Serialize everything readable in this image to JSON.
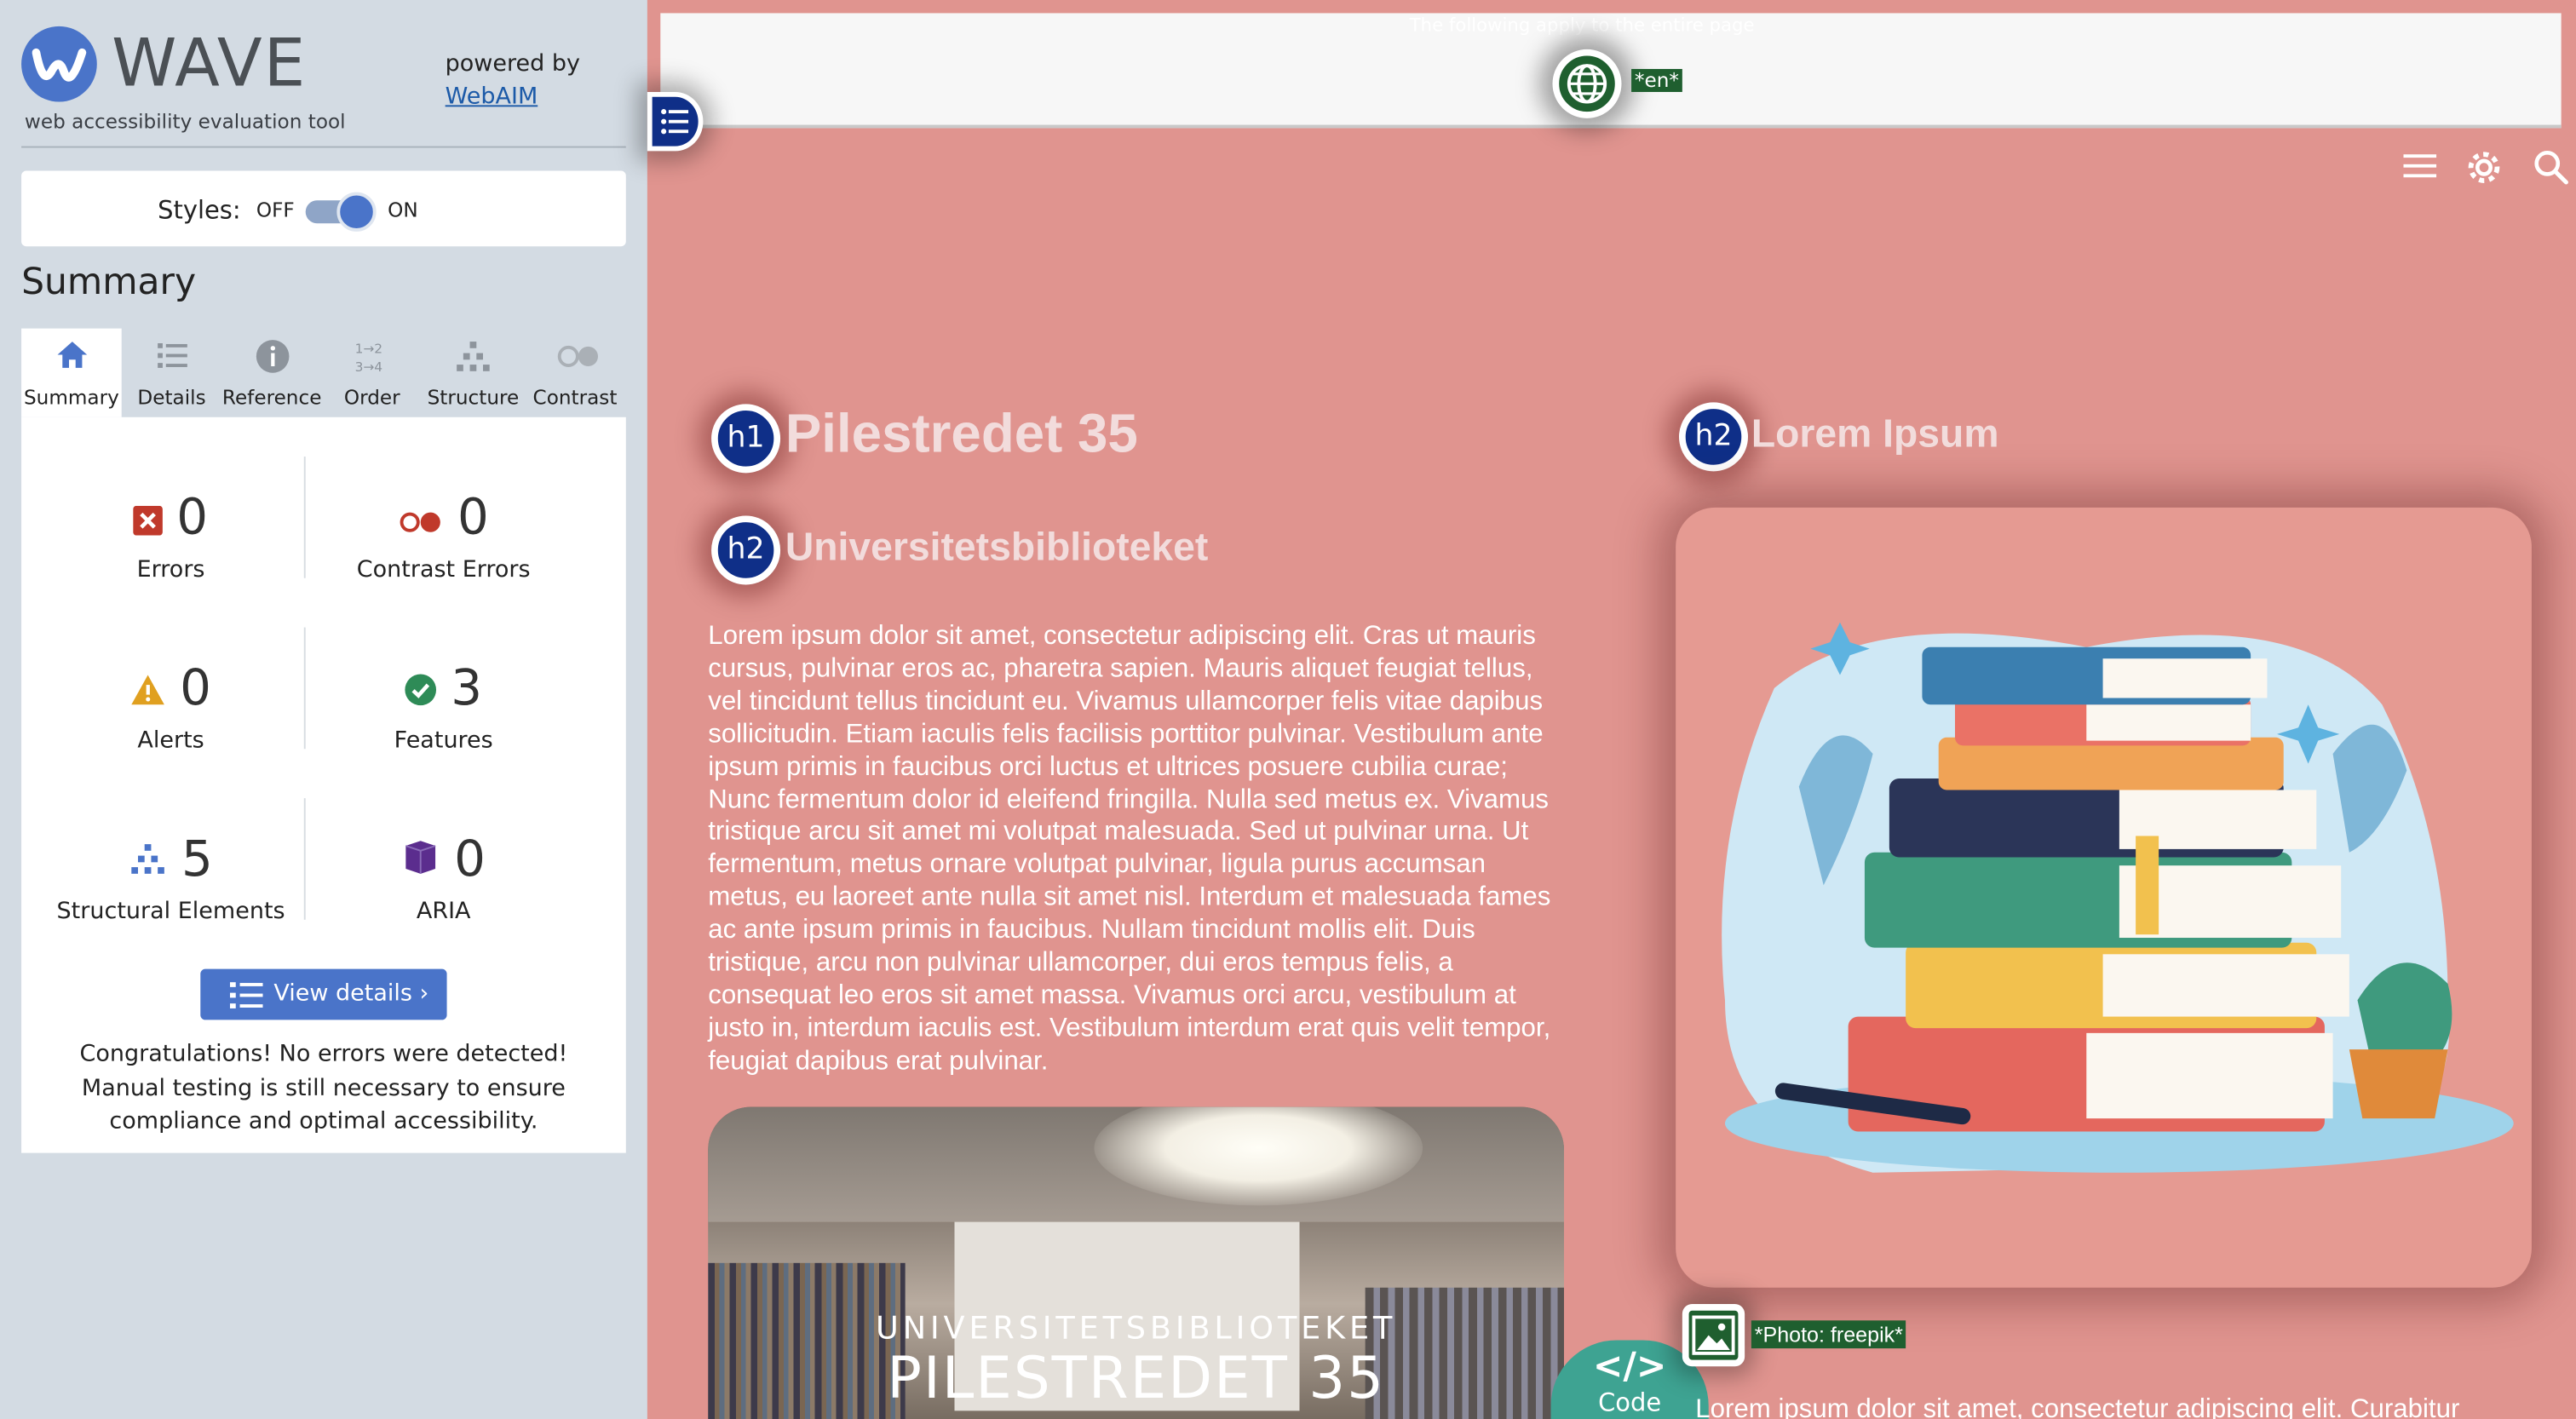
{
  "wave": {
    "logo_text": "WAVE",
    "logo_sub": "web accessibility evaluation tool",
    "powered_by": "powered by",
    "webaim_link": "WebAIM",
    "styles": {
      "label": "Styles:",
      "off": "OFF",
      "on": "ON",
      "value": "ON"
    },
    "summary_heading": "Summary",
    "tabs": [
      {
        "label": "Summary",
        "icon": "home-icon",
        "active": true
      },
      {
        "label": "Details",
        "icon": "list-icon",
        "active": false
      },
      {
        "label": "Reference",
        "icon": "info-icon",
        "active": false
      },
      {
        "label": "Order",
        "icon": "order-icon",
        "active": false
      },
      {
        "label": "Structure",
        "icon": "structure-icon",
        "active": false
      },
      {
        "label": "Contrast",
        "icon": "contrast-icon",
        "active": false
      }
    ],
    "counts": {
      "errors": {
        "value": "0",
        "label": "Errors",
        "color": "#c0392b"
      },
      "contrast_errors": {
        "value": "0",
        "label": "Contrast Errors",
        "color": "#c0392b"
      },
      "alerts": {
        "value": "0",
        "label": "Alerts",
        "color": "#e0a020"
      },
      "features": {
        "value": "3",
        "label": "Features",
        "color": "#2e8b57"
      },
      "structural": {
        "value": "5",
        "label": "Structural Elements",
        "color": "#4a74c9"
      },
      "aria": {
        "value": "0",
        "label": "ARIA",
        "color": "#5b2d8e"
      }
    },
    "view_details": "View details ›",
    "congrats": "Congratulations! No errors were detected! Manual testing is still necessary to ensure compliance and optimal accessibility."
  },
  "page": {
    "skip_text": "The following apply to the entire page",
    "lang_tag": "*en*",
    "h1_badge": "h1",
    "h1": "Pilestredet 35",
    "h2_badge": "h2",
    "h2_left": "Universitetsbiblioteket",
    "h2_right": "Lorem Ipsum",
    "lorem": "Lorem ipsum dolor sit amet, consectetur adipiscing elit. Cras ut mauris cursus, pulvinar eros ac, pharetra sapien. Mauris aliquet feugiat tellus, vel tincidunt tellus tincidunt eu. Vivamus ullamcorper felis vitae dapibus sollicitudin. Etiam iaculis felis facilisis porttitor pulvinar. Vestibulum ante ipsum primis in faucibus orci luctus et ultrices posuere cubilia curae; Nunc fermentum dolor id eleifend fringilla. Nulla sed metus ex. Vivamus tristique arcu sit amet mi volutpat malesuada. Sed ut pulvinar urna. Ut fermentum, metus ornare volutpat pulvinar, ligula purus accumsan metus, eu laoreet ante nulla sit amet nisl. Interdum et malesuada fames ac ante ipsum primis in faucibus. Nullam tincidunt mollis elit. Duis tristique, arcu non pulvinar ullamcorper, dui eros tempus felis, a consequat leo eros sit amet massa. Vivamus orci arcu, vestibulum at justo in, interdum iaculis est. Vestibulum interdum erat quis velit tempor, feugiat dapibus erat pulvinar.",
    "photo_line1": "UNIVERSITETSBIBLIOTEKET",
    "photo_line2": "PILESTREDET 35",
    "code_label": "Code",
    "code_glyph": "</>",
    "photo_credit": "*Photo: freepik*",
    "lorem2": "Lorem ipsum dolor sit amet, consectetur adipiscing elit. Curabitur"
  },
  "colors": {
    "page_bg": "#e0948f",
    "wave_panel": "#d3dbe3",
    "accent": "#4a74c9",
    "badge": "#0f2f88",
    "feature_green": "#1f5f2f",
    "code_teal": "#3ea392"
  }
}
